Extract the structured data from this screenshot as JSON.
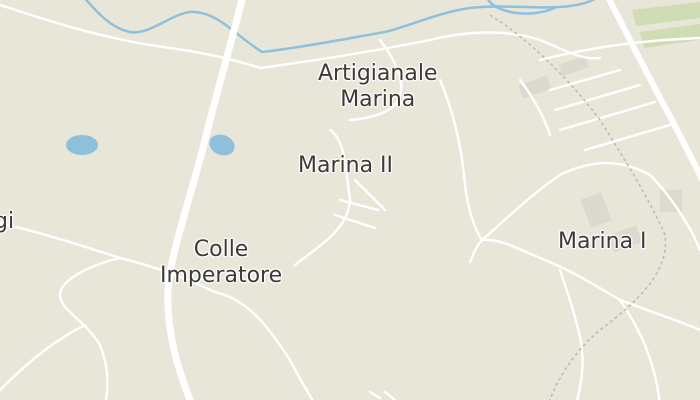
{
  "map": {
    "colors": {
      "land": "#e8e6d9",
      "road": "#ffffff",
      "water": "#8ec0dc",
      "park": "#cfdcb4",
      "building": "#ddd9cf",
      "railway": "#bcb8ae",
      "label_text": "#3d3a36"
    },
    "labels": {
      "artigianale_line1": "Artigianale",
      "artigianale_line2": "Marina",
      "marina2": "Marina II",
      "marina1": "Marina I",
      "colle_line1": "Colle",
      "colle_line2": "Imperatore",
      "partial_left": "gi"
    }
  }
}
